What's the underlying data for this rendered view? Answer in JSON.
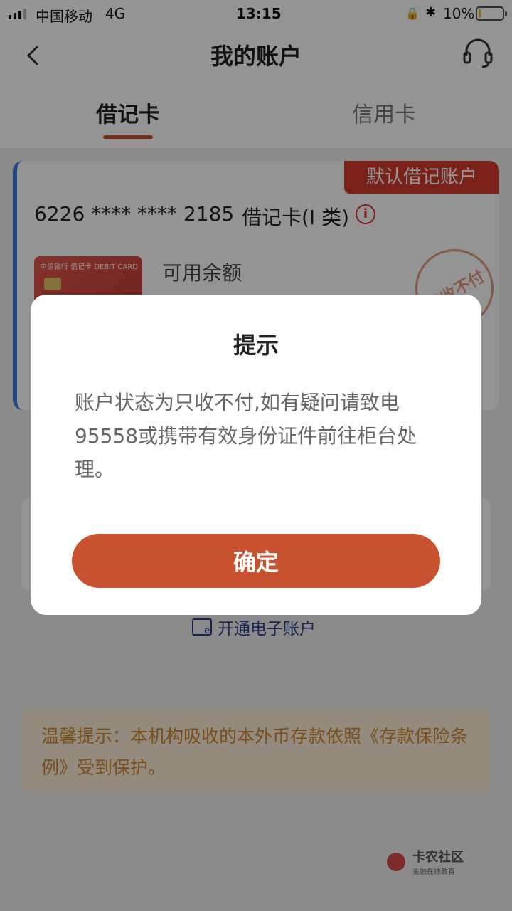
{
  "status_bar": {
    "carrier": "中国移动",
    "network": "4G",
    "time": "13:15",
    "battery_percent": "10%",
    "battery_level": 0.1
  },
  "header": {
    "title": "我的账户",
    "back_icon": "chevron-left-icon",
    "support_icon": "headset-icon"
  },
  "tabs": [
    {
      "label": "借记卡",
      "active": true
    },
    {
      "label": "信用卡",
      "active": false
    }
  ],
  "card": {
    "badge": "默认借记账户",
    "number": "6226 **** **** 2185",
    "type": "借记卡(I 类)",
    "balance_label": "可用余额",
    "stamp": "只收不付",
    "mini_card_text": "中信银行  借记卡 DEBIT CARD"
  },
  "e_account_link": "开通电子账户",
  "notice": "温馨提示：本机构吸收的本外币存款依照《存款保险条例》受到保护。",
  "watermark": {
    "title": "卡农社区",
    "subtitle": "金融在线教育"
  },
  "dialog": {
    "title": "提示",
    "message": "账户状态为只收不付,如有疑问请致电95558或携带有效身份证件前往柜台处理。",
    "confirm": "确定"
  },
  "colors": {
    "accent": "#c8522f",
    "badge_red": "#d33a2c",
    "card_stripe": "#3b7fe0",
    "link_blue": "#2c3e8f",
    "notice_bg": "#fdf0dc",
    "notice_text": "#d0852a"
  }
}
